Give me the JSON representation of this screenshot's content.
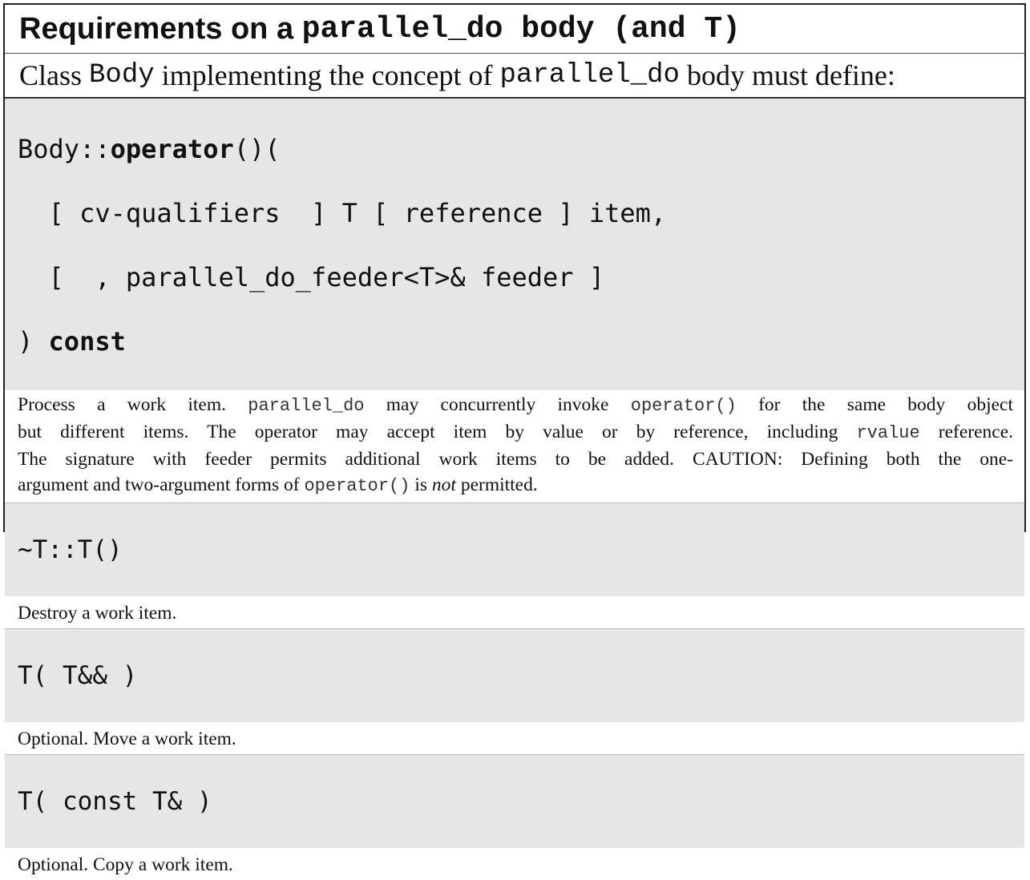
{
  "title": {
    "prefix": "Requirements on a ",
    "code": "parallel_do body",
    "suffix": " (and T)"
  },
  "intro": {
    "t1": "Class ",
    "c1": "Body",
    "t2": " implementing the concept of ",
    "c2": "parallel_do",
    "t3": " body must define:"
  },
  "operator_sig": {
    "l1_prefix": "Body::",
    "l1_kw": "operator",
    "l1_suffix": "()(",
    "l2": "  [ cv-qualifiers  ] T [ reference ] item,",
    "l3": "  [  , parallel_do_feeder<T>& feeder ]",
    "l4_prefix": ") ",
    "l4_kw": "const"
  },
  "operator_desc": {
    "a1": "Process a work item. ",
    "a2": "parallel_do",
    "a3": " may concurrently invoke ",
    "a4": "operator()",
    "a5": " for the same body object",
    "b1": "but different items. The operator may accept item by value or by reference, including ",
    "b2": "rvalue",
    "b3": " reference.",
    "c1": "The signature with feeder permits additional work items to be added. CAUTION: Defining both the one-",
    "d1": "argument and two-argument forms of ",
    "d2": "operator()",
    "d3": " is ",
    "d4": "not",
    "d5": " permitted."
  },
  "destructor": {
    "sig": "~T::T()",
    "desc": "Destroy a work item."
  },
  "move_ctor": {
    "sig": "T( T&& )",
    "desc": "Optional. Move a work item."
  },
  "copy_ctor": {
    "sig": "T( const T& )",
    "desc": "Optional. Copy a work item."
  }
}
